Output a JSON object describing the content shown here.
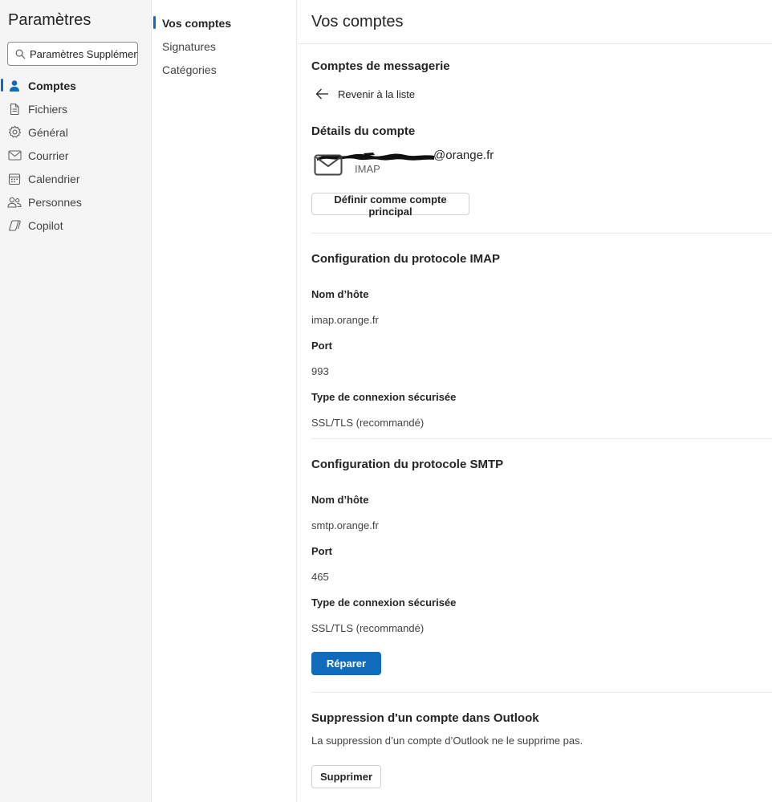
{
  "nav": {
    "title": "Paramètres",
    "search": {
      "value": "Paramètres Supplémen",
      "placeholder": ""
    },
    "items": [
      {
        "label": "Comptes",
        "icon": "person-icon",
        "active": true
      },
      {
        "label": "Fichiers",
        "icon": "document-icon",
        "active": false
      },
      {
        "label": "Général",
        "icon": "gear-icon",
        "active": false
      },
      {
        "label": "Courrier",
        "icon": "mail-icon",
        "active": false
      },
      {
        "label": "Calendrier",
        "icon": "calendar-icon",
        "active": false
      },
      {
        "label": "Personnes",
        "icon": "people-icon",
        "active": false
      },
      {
        "label": "Copilot",
        "icon": "copilot-icon",
        "active": false
      }
    ]
  },
  "subnav": {
    "items": [
      {
        "label": "Vos comptes",
        "active": true
      },
      {
        "label": "Signatures",
        "active": false
      },
      {
        "label": "Catégories",
        "active": false
      }
    ]
  },
  "main": {
    "title": "Vos comptes",
    "mail_accounts_heading": "Comptes de messagerie",
    "back_label": "Revenir à la liste",
    "account_details_heading": "Détails du compte",
    "account": {
      "email_suffix": "@orange.fr",
      "type": "IMAP"
    },
    "set_primary_button": "Définir comme compte principal",
    "imap": {
      "heading": "Configuration du protocole IMAP",
      "host_label": "Nom d’hôte",
      "host_value": "imap.orange.fr",
      "port_label": "Port",
      "port_value": "993",
      "security_label": "Type de connexion sécurisée",
      "security_value": "SSL/TLS (recommandé)"
    },
    "smtp": {
      "heading": "Configuration du protocole SMTP",
      "host_label": "Nom d’hôte",
      "host_value": "smtp.orange.fr",
      "port_label": "Port",
      "port_value": "465",
      "security_label": "Type de connexion sécurisée",
      "security_value": "SSL/TLS (recommandé)"
    },
    "repair_button": "Réparer",
    "remove": {
      "heading": "Suppression d'un compte dans Outlook",
      "description": "La suppression d’un compte d’Outlook ne le supprime pas.",
      "button": "Supprimer"
    }
  },
  "colors": {
    "accent": "#0f6cbd",
    "nav_bg": "#f5f5f5",
    "divider": "#e6e6e6"
  }
}
